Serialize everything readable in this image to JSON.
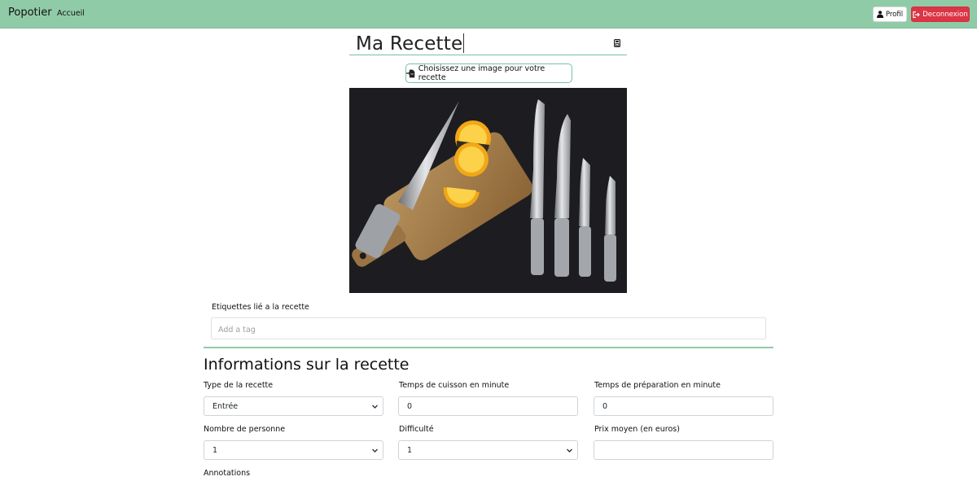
{
  "navbar": {
    "brand": "Popotier",
    "home_link": "Accueil",
    "profile_button": "Profil",
    "logout_button": "Deconnexion"
  },
  "recipe": {
    "title": "Ma Recette",
    "image_button": "Choisissez une image pour votre recette"
  },
  "tags": {
    "label": "Etiquettes lié a la recette",
    "placeholder": "Add a tag"
  },
  "info": {
    "section_title": "Informations sur la recette",
    "fields": {
      "type": {
        "label": "Type de la recette",
        "value": "Entrée"
      },
      "cooking_time": {
        "label": "Temps de cuisson en minute",
        "value": "0"
      },
      "prep_time": {
        "label": "Temps de préparation en minute",
        "value": "0"
      },
      "people": {
        "label": "Nombre de personne",
        "value": "1"
      },
      "difficulty": {
        "label": "Difficulté",
        "value": "1"
      },
      "price": {
        "label": "Prix moyen (en euros)",
        "value": ""
      }
    },
    "annotations_label": "Annotations"
  },
  "colors": {
    "navbar": "#90cba8",
    "accent": "#7bc0a0",
    "danger": "#dc3545"
  },
  "icons": {
    "profile": "user-icon",
    "logout": "sign-out-icon",
    "title": "save-icon",
    "image_button": "file-import-icon"
  }
}
